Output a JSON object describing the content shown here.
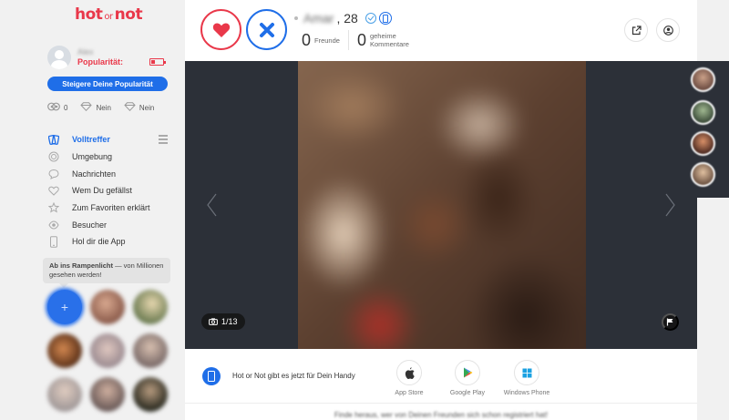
{
  "logo": {
    "part1": "hot",
    "part2": "or",
    "part3": "not"
  },
  "sidebar": {
    "user_name": "Alex",
    "popularity_label": "Popularität:",
    "cta_label": "Steigere Deine Popularität",
    "stats": [
      {
        "icon": "eyes-icon",
        "value": "0"
      },
      {
        "icon": "diamond-icon",
        "value": "Nein"
      },
      {
        "icon": "diamond-icon",
        "value": "Nein"
      }
    ],
    "nav": [
      {
        "label": "Volltreffer",
        "icon": "match-icon",
        "active": true
      },
      {
        "label": "Umgebung",
        "icon": "target-icon"
      },
      {
        "label": "Nachrichten",
        "icon": "chat-icon"
      },
      {
        "label": "Wem Du gefällst",
        "icon": "heart-icon"
      },
      {
        "label": "Zum Favoriten erklärt",
        "icon": "star-icon"
      },
      {
        "label": "Besucher",
        "icon": "eye-icon"
      },
      {
        "label": "Hol dir die App",
        "icon": "mobile-icon"
      }
    ],
    "spotlight_bold": "Ab ins Rampenlicht",
    "spotlight_text": " — von Millionen gesehen werden!"
  },
  "profile": {
    "name": "Amar",
    "age": ", 28",
    "friends_count": "0",
    "friends_label": "Freunde",
    "comments_count": "0",
    "comments_label_1": "geheime",
    "comments_label_2": "Kommentare"
  },
  "gallery": {
    "counter": "1/13"
  },
  "app_bar": {
    "text": "Hot or Not gibt es jetzt für Dein Handy",
    "stores": [
      "App Store",
      "Google Play",
      "Windows Phone"
    ]
  },
  "footer_note": "Finde heraus, wer von Deinen Freunden sich schon registriert hat!",
  "colors": {
    "accent_red": "#e9384a",
    "accent_blue": "#1f6ee8",
    "dark_gallery": "#2c3038"
  }
}
